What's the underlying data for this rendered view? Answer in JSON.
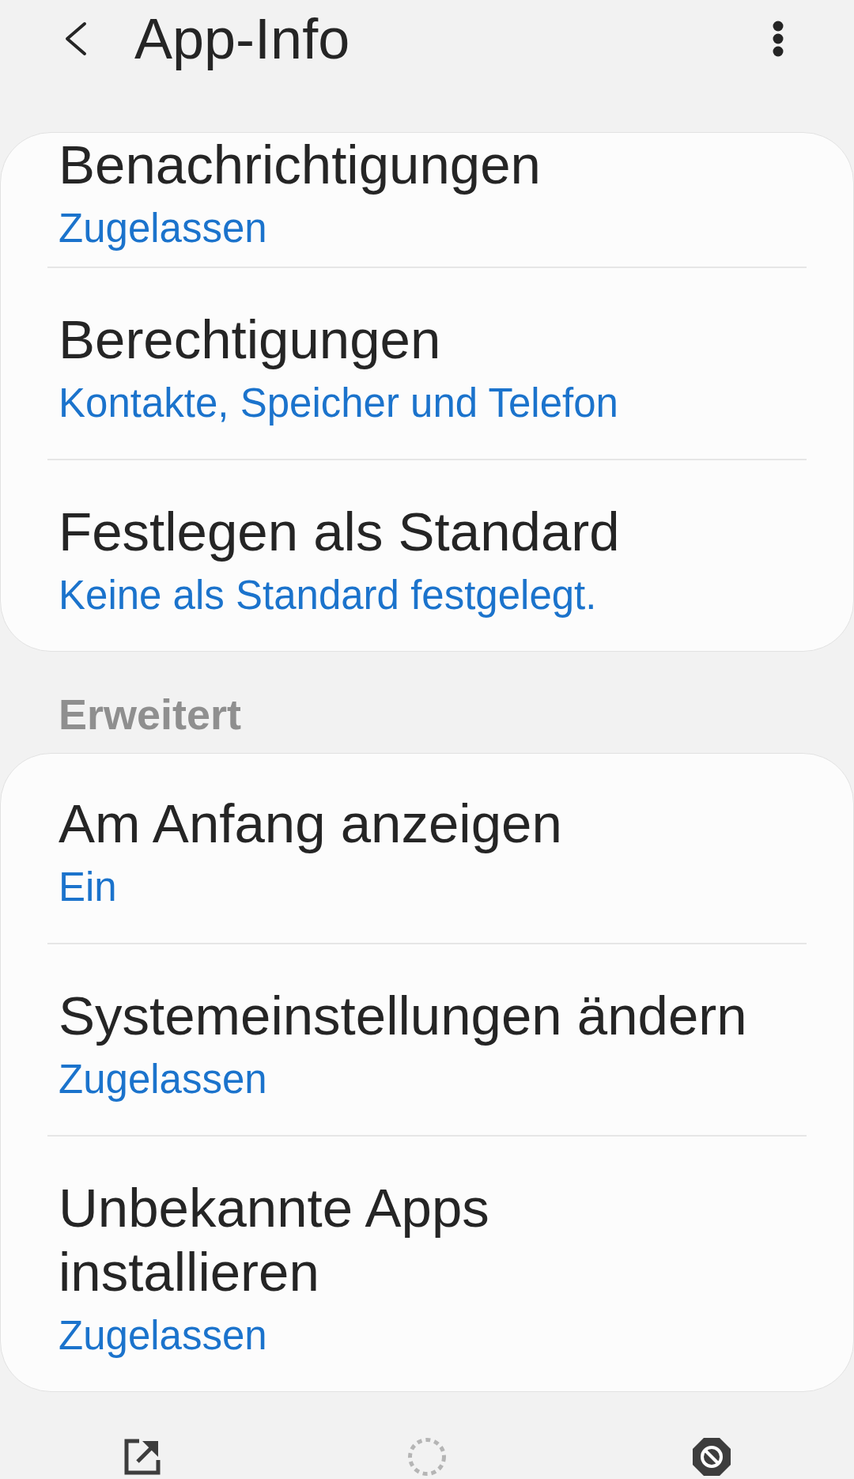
{
  "header": {
    "title": "App-Info"
  },
  "sections": [
    {
      "items": [
        {
          "title": "Benachrichtigungen",
          "value": "Zugelassen"
        },
        {
          "title": "Berechtigungen",
          "value": "Kontakte, Speicher und Telefon"
        },
        {
          "title": "Festlegen als Standard",
          "value": "Keine als Standard festgelegt."
        }
      ]
    },
    {
      "heading": "Erweitert",
      "items": [
        {
          "title": "Am Anfang anzeigen",
          "value": "Ein"
        },
        {
          "title": "Systemeinstellungen ändern",
          "value": "Zugelassen"
        },
        {
          "title": "Unbekannte Apps installieren",
          "value": "Zugelassen"
        }
      ]
    }
  ],
  "bottom_actions": [
    {
      "kind": "open",
      "disabled": false
    },
    {
      "kind": "disable",
      "disabled": true
    },
    {
      "kind": "force_stop",
      "disabled": false
    }
  ]
}
